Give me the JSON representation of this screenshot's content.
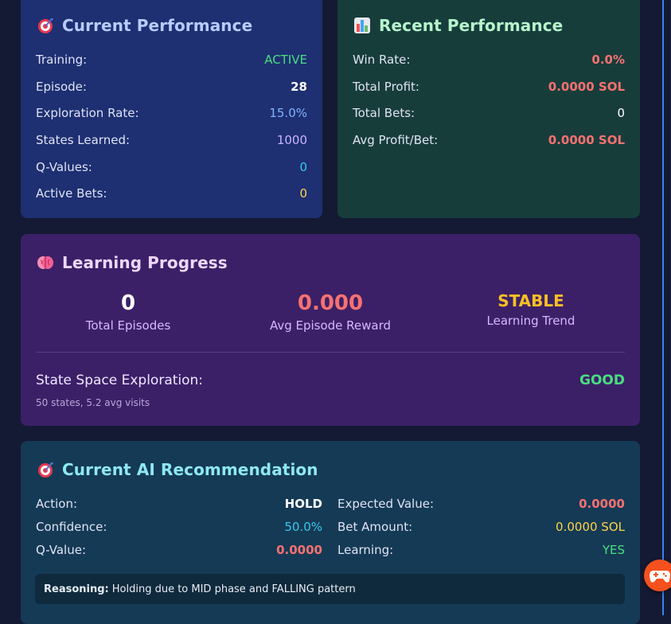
{
  "current_performance": {
    "title": "Current Performance",
    "icon": "target-icon",
    "rows": [
      {
        "label": "Training:",
        "value": "ACTIVE"
      },
      {
        "label": "Episode:",
        "value": "28"
      },
      {
        "label": "Exploration Rate:",
        "value": "15.0%"
      },
      {
        "label": "States Learned:",
        "value": "1000"
      },
      {
        "label": "Q-Values:",
        "value": "0"
      },
      {
        "label": "Active Bets:",
        "value": "0"
      }
    ]
  },
  "recent_performance": {
    "title": "Recent Performance",
    "icon": "bar-chart-icon",
    "rows": [
      {
        "label": "Win Rate:",
        "value": "0.0%"
      },
      {
        "label": "Total Profit:",
        "value": "0.0000 SOL"
      },
      {
        "label": "Total Bets:",
        "value": "0"
      },
      {
        "label": "Avg Profit/Bet:",
        "value": "0.0000 SOL"
      }
    ]
  },
  "learning_progress": {
    "title": "Learning Progress",
    "icon": "brain-icon",
    "stats": [
      {
        "value": "0",
        "caption": "Total Episodes"
      },
      {
        "value": "0.000",
        "caption": "Avg Episode Reward"
      },
      {
        "value": "STABLE",
        "caption": "Learning Trend"
      }
    ],
    "exploration_label": "State Space Exploration:",
    "exploration_value": "GOOD",
    "exploration_detail": "50 states, 5.2 avg visits"
  },
  "recommendation": {
    "title": "Current AI Recommendation",
    "icon": "target-icon",
    "left": [
      {
        "label": "Action:",
        "value": "HOLD"
      },
      {
        "label": "Confidence:",
        "value": "50.0%"
      },
      {
        "label": "Q-Value:",
        "value": "0.0000"
      }
    ],
    "right": [
      {
        "label": "Expected Value:",
        "value": "0.0000"
      },
      {
        "label": "Bet Amount:",
        "value": "0.0000 SOL"
      },
      {
        "label": "Learning:",
        "value": "YES"
      }
    ],
    "reasoning_label": "Reasoning:",
    "reasoning_text": "Holding due to MID phase and FALLING pattern"
  },
  "fab": {
    "icon": "gamepad-icon"
  },
  "colors": {
    "accent_blue": "#3b82f6",
    "positive": "#4ade80",
    "negative": "#f87171",
    "warning": "#fbbf24"
  }
}
